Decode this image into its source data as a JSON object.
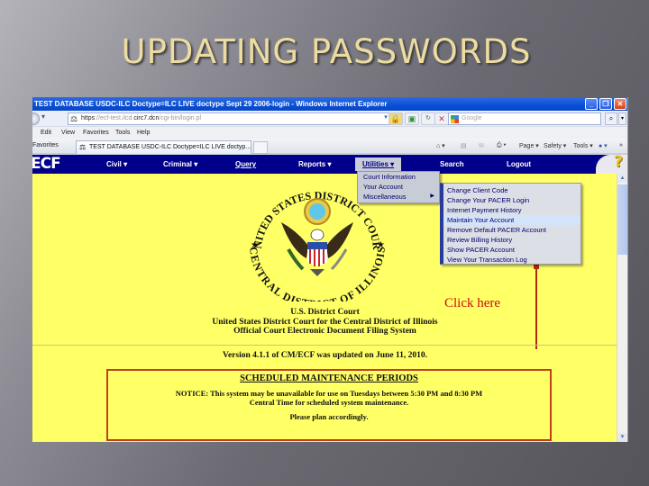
{
  "slide": {
    "title": "UPDATING PASSWORDS"
  },
  "browser": {
    "window_title": "TEST DATABASE USDC-ILC Doctype=ILC LIVE doctype Sept 29 2006-login - Windows Internet Explorer",
    "window_buttons": {
      "minimize": "_",
      "maximize": "❐",
      "close": "✕"
    },
    "address": {
      "protocol": "https",
      "prefix": "://ecf-test.ilcd.",
      "host": "circ7.dcn",
      "path": "/cgi-bin/login.pl"
    },
    "search_placeholder": "Google",
    "menu": [
      "Edit",
      "View",
      "Favorites",
      "Tools",
      "Help"
    ],
    "favorites_label": "Favorites",
    "tab_title": "TEST DATABASE USDC-ILC Doctype=ILC LIVE doctyp...",
    "command_bar": [
      "Page ▾",
      "Safety ▾",
      "Tools ▾"
    ]
  },
  "ecf": {
    "logo": "ECF",
    "nav": [
      {
        "label": "Civil ▾"
      },
      {
        "label": "Criminal ▾"
      },
      {
        "label": "Query"
      },
      {
        "label": "Reports ▾"
      },
      {
        "label": "Utilities ▾"
      },
      {
        "label": "Search"
      },
      {
        "label": "Logout"
      }
    ],
    "help_icon": "?",
    "utilities_menu": [
      {
        "label": "Court Information"
      },
      {
        "label": "Your Account"
      },
      {
        "label": "Miscellaneous",
        "submenu_arrow": "▶"
      }
    ],
    "account_menu": [
      {
        "label": "Change Client Code"
      },
      {
        "label": "Change Your PACER Login"
      },
      {
        "label": "Internet Payment History"
      },
      {
        "label": "Maintain Your Account",
        "highlighted": true
      },
      {
        "label": "Remove Default PACER Account"
      },
      {
        "label": "Review Billing History"
      },
      {
        "label": "Show PACER Account"
      },
      {
        "label": "View Your Transaction Log"
      }
    ],
    "seal": {
      "top_text": "UNITED STATES DISTRICT COURT",
      "bottom_text": "CENTRAL DISTRICT OF ILLINOIS"
    },
    "court_lines": [
      "U.S. District Court",
      "United States District Court for the Central District of Illinois",
      "Official Court Electronic Document Filing System"
    ],
    "version_text": "Version 4.1.1 of CM/ECF was updated on June 11, 2010.",
    "maintenance": {
      "title": "SCHEDULED MAINTENANCE PERIODS",
      "notice_line1": "NOTICE:   This system may be unavailable for use on Tuesdays between 5:30 PM and 8:30 PM",
      "notice_line2": "Central Time for scheduled system maintenance.",
      "plan": "Please plan accordingly."
    }
  },
  "annotation": {
    "label": "Click here",
    "color": "#cc1010"
  }
}
